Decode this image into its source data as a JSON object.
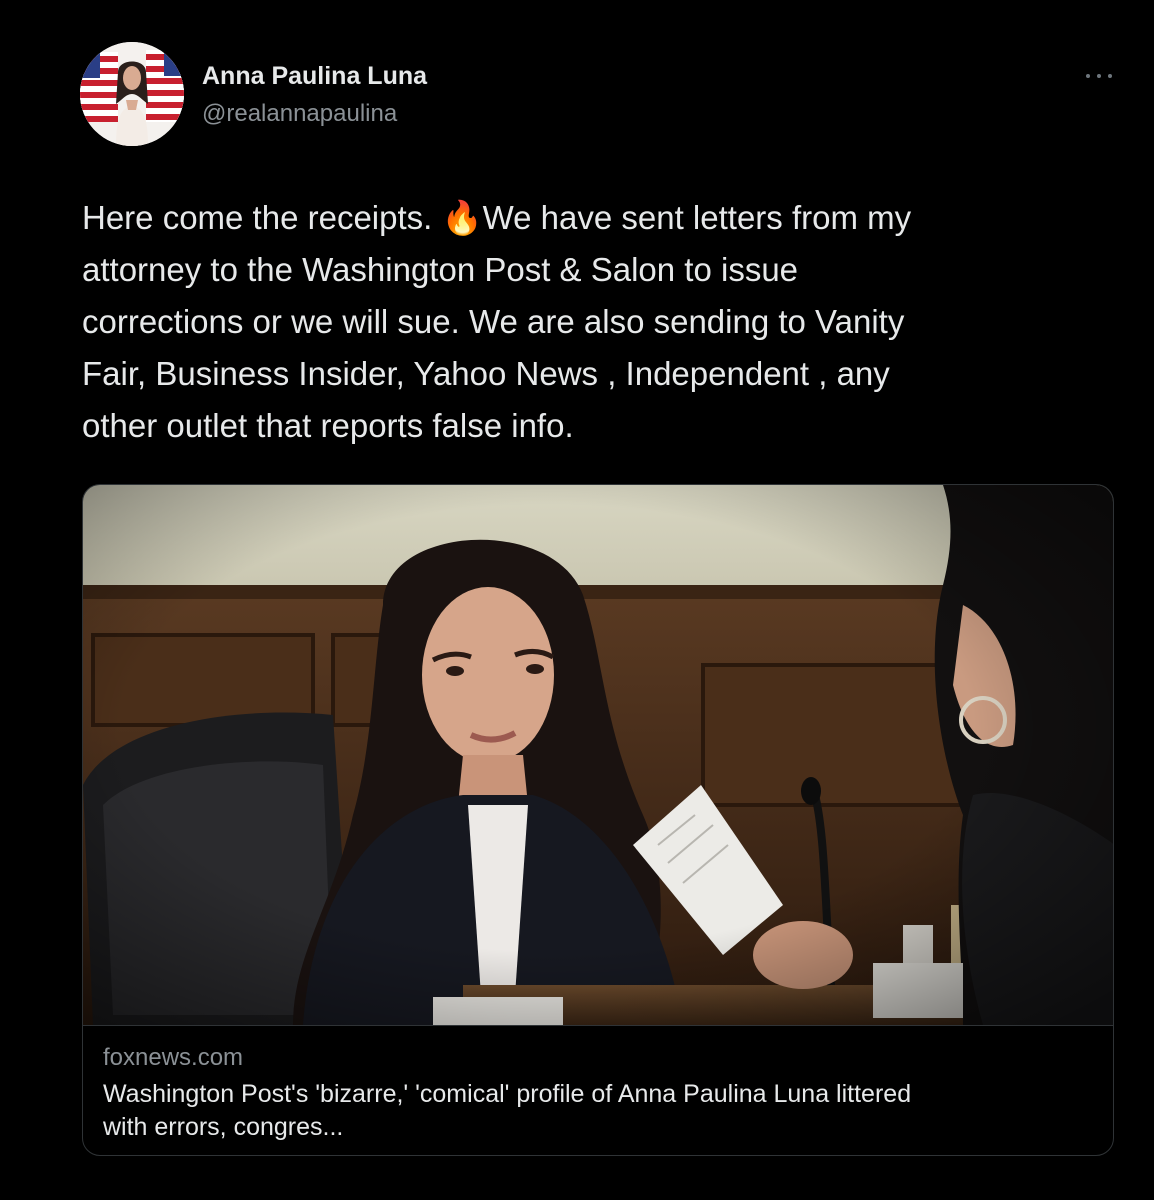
{
  "tweet": {
    "author": {
      "display_name": "Anna Paulina Luna",
      "handle": "@realannapaulina"
    },
    "more_menu_icon": "ellipsis-icon",
    "text": "Here come the receipts. 🔥We have sent letters from my\nattorney to the Washington Post & Salon to issue\ncorrections or we will sue. We are also sending to Vanity\nFair, Business Insider, Yahoo News , Independent , any\nother outlet that reports false info.",
    "link_card": {
      "domain": "foxnews.com",
      "title": "Washington Post's 'bizarre,' 'comical' profile of Anna Paulina Luna littered\nwith errors, congres..."
    }
  },
  "colors": {
    "background": "#000000",
    "primary_text": "#e7e9ea",
    "secondary_text": "#8b9196",
    "border": "#2f3336"
  }
}
